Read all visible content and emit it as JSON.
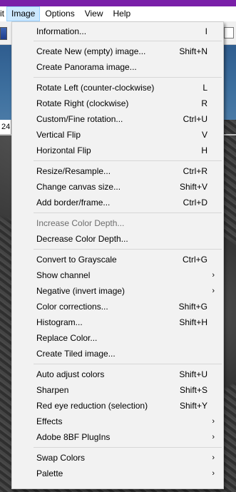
{
  "menubar": {
    "items": [
      {
        "label": "it",
        "active": false
      },
      {
        "label": "Image",
        "active": true
      },
      {
        "label": "Options",
        "active": false
      },
      {
        "label": "View",
        "active": false
      },
      {
        "label": "Help",
        "active": false
      }
    ]
  },
  "status": {
    "left_text": "24"
  },
  "colors": {
    "accent": "#7a1fa8",
    "menu_highlight": "#cce8ff",
    "menu_bg": "#f2f2f2"
  },
  "menu": {
    "items": [
      {
        "label": "Information...",
        "shortcut": "I"
      },
      {
        "label": "Create New (empty) image...",
        "shortcut": "Shift+N"
      },
      {
        "label": "Create Panorama image...",
        "shortcut": ""
      },
      {
        "label": "Rotate Left (counter-clockwise)",
        "shortcut": "L"
      },
      {
        "label": "Rotate Right (clockwise)",
        "shortcut": "R"
      },
      {
        "label": "Custom/Fine rotation...",
        "shortcut": "Ctrl+U"
      },
      {
        "label": "Vertical Flip",
        "shortcut": "V"
      },
      {
        "label": "Horizontal Flip",
        "shortcut": "H"
      },
      {
        "label": "Resize/Resample...",
        "shortcut": "Ctrl+R"
      },
      {
        "label": "Change canvas size...",
        "shortcut": "Shift+V"
      },
      {
        "label": "Add border/frame...",
        "shortcut": "Ctrl+D"
      },
      {
        "label": "Increase Color Depth...",
        "shortcut": "",
        "disabled": true
      },
      {
        "label": "Decrease Color Depth...",
        "shortcut": ""
      },
      {
        "label": "Convert to Grayscale",
        "shortcut": "Ctrl+G"
      },
      {
        "label": "Show channel",
        "shortcut": "",
        "submenu": true
      },
      {
        "label": "Negative (invert image)",
        "shortcut": "",
        "submenu": true
      },
      {
        "label": "Color corrections...",
        "shortcut": "Shift+G"
      },
      {
        "label": "Histogram...",
        "shortcut": "Shift+H"
      },
      {
        "label": "Replace Color...",
        "shortcut": ""
      },
      {
        "label": "Create Tiled image...",
        "shortcut": ""
      },
      {
        "label": "Auto adjust colors",
        "shortcut": "Shift+U"
      },
      {
        "label": "Sharpen",
        "shortcut": "Shift+S"
      },
      {
        "label": "Red eye reduction (selection)",
        "shortcut": "Shift+Y"
      },
      {
        "label": "Effects",
        "shortcut": "",
        "submenu": true
      },
      {
        "label": "Adobe 8BF PlugIns",
        "shortcut": "",
        "submenu": true
      },
      {
        "label": "Swap Colors",
        "shortcut": "",
        "submenu": true
      },
      {
        "label": "Palette",
        "shortcut": "",
        "submenu": true
      }
    ],
    "submenu_glyph": "›"
  }
}
